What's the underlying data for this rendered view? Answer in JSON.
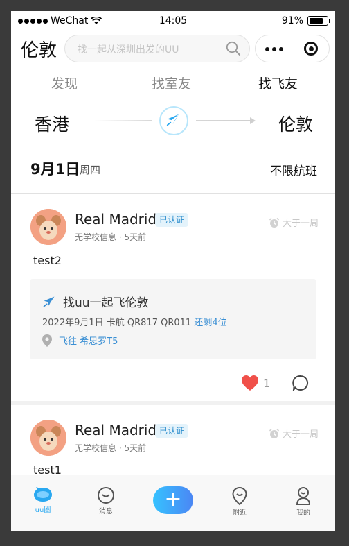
{
  "status_bar": {
    "carrier": "WeChat",
    "time": "14:05",
    "battery": "91%",
    "battery_level": 0.91
  },
  "header": {
    "city": "伦敦",
    "search_placeholder": "找一起从深圳出发的UU"
  },
  "tabs": [
    {
      "label": "发现",
      "active": false
    },
    {
      "label": "找室友",
      "active": false
    },
    {
      "label": "找飞友",
      "active": true
    }
  ],
  "route": {
    "from": "香港",
    "to": "伦敦"
  },
  "date_filter": {
    "date": "9月1日",
    "weekday": "周四",
    "flight_filter": "不限航班"
  },
  "posts": [
    {
      "user": "Real Madrid",
      "badge": "已认证",
      "meta": "无学校信息 · 5天前",
      "time_label": "大于一周",
      "text": "test2",
      "flight": {
        "title": "找uu一起飞伦敦",
        "detail": "2022年9月1日 卡航 QR817 QR011",
        "remaining": "还剩4位",
        "destination": "飞往 希思罗T5"
      },
      "likes": "1"
    },
    {
      "user": "Real Madrid",
      "badge": "已认证",
      "meta": "无学校信息 · 5天前",
      "time_label": "大于一周",
      "text": "test1"
    }
  ],
  "tabbar": {
    "items": [
      {
        "label": "uu圈",
        "icon": "uu-circle-icon",
        "active": true
      },
      {
        "label": "消息",
        "icon": "message-icon"
      },
      {
        "label": "+",
        "icon": "plus-icon"
      },
      {
        "label": "附近",
        "icon": "location-pin-icon"
      },
      {
        "label": "我的",
        "icon": "profile-icon"
      }
    ]
  },
  "colors": {
    "accent": "#29a8f0",
    "badge_bg": "#e4f3fb",
    "heart": "#f0504a",
    "background": "#3a3a3a"
  }
}
